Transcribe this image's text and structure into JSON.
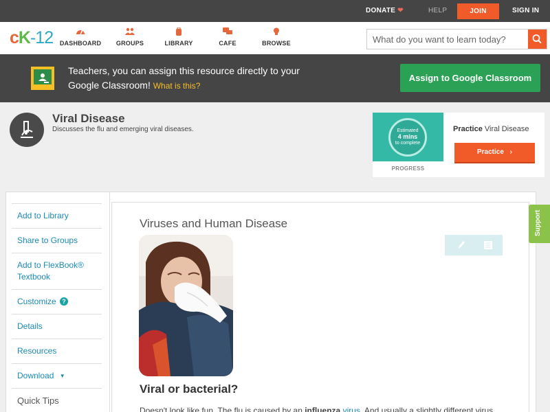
{
  "topbar": {
    "donate": "DONATE",
    "help": "HELP",
    "join": "JOIN",
    "signin": "SIGN IN"
  },
  "logo": {
    "c": "c",
    "k": "K",
    "n": "-12"
  },
  "nav": {
    "items": [
      {
        "label": "DASHBOARD",
        "icon": "dashboard-gauge-icon"
      },
      {
        "label": "GROUPS",
        "icon": "groups-people-icon"
      },
      {
        "label": "LIBRARY",
        "icon": "library-backpack-icon"
      },
      {
        "label": "CAFE",
        "icon": "cafe-chat-icon"
      },
      {
        "label": "BROWSE",
        "icon": "browse-lightbulb-icon"
      }
    ]
  },
  "search": {
    "placeholder": "What do you want to learn today?"
  },
  "banner": {
    "message": "Teachers, you can assign this resource directly to your Google Classroom!",
    "what_link": "What is this?",
    "assign_button": "Assign to Google Classroom"
  },
  "concept": {
    "title": "Viral Disease",
    "description": "Discusses the flu and emerging viral diseases."
  },
  "practice": {
    "estimate_top": "Estimated",
    "estimate_mins": "4 mins",
    "estimate_bottom": "to complete",
    "progress_label": "PROGRESS",
    "title_bold": "Practice",
    "title_rest": "Viral Disease",
    "button": "Practice"
  },
  "sidebar": {
    "add_library": "Add to Library",
    "share_groups": "Share to Groups",
    "add_flexbook": "Add to FlexBook® Textbook",
    "customize": "Customize",
    "details": "Details",
    "resources": "Resources",
    "download": "Download",
    "quick_tips": "Quick Tips"
  },
  "main": {
    "heading": "Viruses and Human Disease",
    "subheading": "Viral or bacterial?",
    "para_1": "Doesn't look like fun. The flu is caused by an ",
    "para_bold": "influenza",
    "para_link": "virus",
    "para_2": ". And usually a slightly different virus"
  },
  "support": "Support",
  "colors": {
    "accent_orange": "#f15a29",
    "classroom_green": "#2aa155",
    "link_blue": "#1a8ab5",
    "support_green": "#8bc34a"
  }
}
